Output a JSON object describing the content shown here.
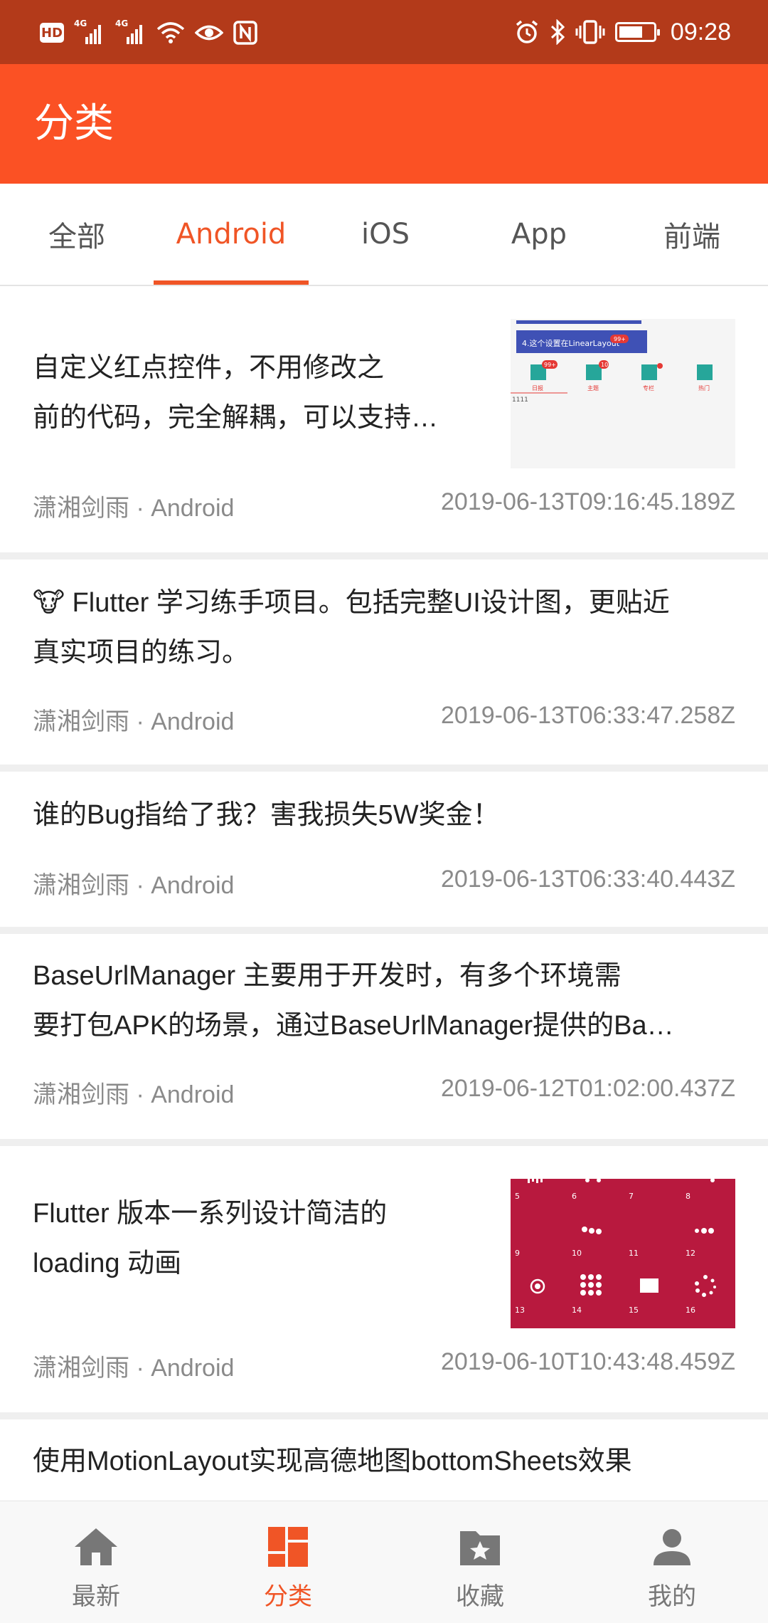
{
  "status_bar": {
    "time": "09:28",
    "hd_badge": "HD",
    "network_1": "4G",
    "network_2": "4G",
    "icons": [
      "hd-icon",
      "signal-icon",
      "signal-icon",
      "wifi-icon",
      "eye-icon",
      "nfc-icon",
      "alarm-icon",
      "bluetooth-icon",
      "vibrate-icon",
      "battery-icon"
    ]
  },
  "app_bar": {
    "title": "分类"
  },
  "tabs": [
    {
      "label": "全部",
      "active": false
    },
    {
      "label": "Android",
      "active": true
    },
    {
      "label": "iOS",
      "active": false
    },
    {
      "label": "App",
      "active": false
    },
    {
      "label": "前端",
      "active": false
    }
  ],
  "articles": [
    {
      "title_line1": "自定义红点控件，不用修改之",
      "title_line2": "前的代码，完全解耦，可以支持…",
      "meta": "潇湘剑雨 · Android",
      "date": "2019-06-13T09:16:45.189Z",
      "thumbnail": {
        "caption": "4.这个设置在LinearLayout",
        "badge": "99+",
        "badges": [
          "99+",
          "10",
          ""
        ],
        "labels": [
          "日报",
          "主题",
          "专栏",
          "热门"
        ],
        "counter": "1111"
      }
    },
    {
      "emoji": "🐮",
      "title_line1": "Flutter 学习练手项目。包括完整UI设计图，更贴近",
      "title_line2": "真实项目的练习。",
      "meta": "潇湘剑雨 · Android",
      "date": "2019-06-13T06:33:47.258Z"
    },
    {
      "title_line1": "谁的Bug指给了我？害我损失5W奖金！",
      "meta": "潇湘剑雨 · Android",
      "date": "2019-06-13T06:33:40.443Z"
    },
    {
      "title_line1": "BaseUrlManager 主要用于开发时，有多个环境需",
      "title_line2": "要打包APK的场景，通过BaseUrlManager提供的Ba…",
      "meta": "潇湘剑雨 · Android",
      "date": "2019-06-12T01:02:00.437Z"
    },
    {
      "title_line1": "Flutter 版本一系列设计简洁的",
      "title_line2": "loading 动画",
      "meta": "潇湘剑雨 · Android",
      "date": "2019-06-10T10:43:48.459Z",
      "thumbnail": {
        "numbers": [
          "5",
          "6",
          "7",
          "8",
          "9",
          "10",
          "11",
          "12",
          "13",
          "14",
          "15",
          "16"
        ],
        "bg_color": "#b8193e"
      }
    },
    {
      "title_line1": "使用MotionLayout实现高德地图bottomSheets效果"
    }
  ],
  "bottom_nav": [
    {
      "label": "最新",
      "icon": "home-icon",
      "active": false
    },
    {
      "label": "分类",
      "icon": "category-grid-icon",
      "active": true
    },
    {
      "label": "收藏",
      "icon": "folder-star-icon",
      "active": false
    },
    {
      "label": "我的",
      "icon": "person-icon",
      "active": false
    }
  ],
  "colors": {
    "status_bar": "#b33a1a",
    "app_bar": "#fb5124",
    "accent": "#f05526",
    "text_primary": "#222222",
    "text_secondary": "#8a8a8a",
    "thumbnail_loading_bg": "#b8193e"
  }
}
